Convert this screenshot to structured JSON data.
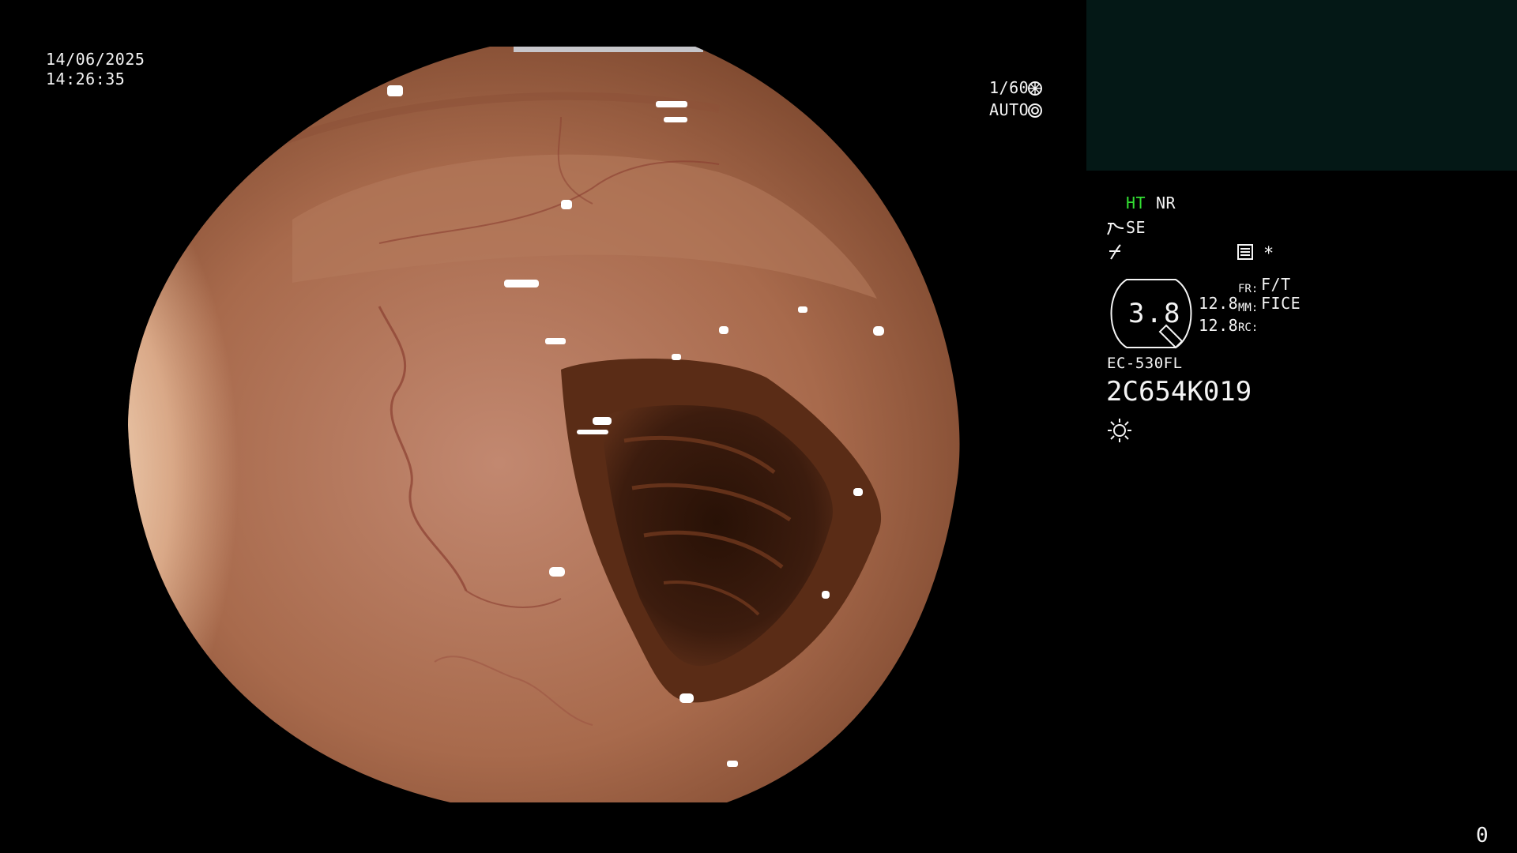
{
  "overlay": {
    "date": "14/06/2025",
    "time": "14:26:35",
    "shutter": "1/60",
    "exposure": "AUTO",
    "counter": "0"
  },
  "processor": {
    "ht_label": "HT",
    "nr_label": "NR",
    "se_label": "SE",
    "asterisk": "*",
    "zoom_value": "3.8",
    "values": [
      "12.8",
      "12.8"
    ],
    "fr_label": "FR:",
    "fr_value": "F/T",
    "mm_label": "MM:",
    "mm_value": "FICE",
    "rc_label": "RC:",
    "scope_model": "EC-530FL",
    "serial": "2C654K019"
  },
  "colors": {
    "ht_green": "#33e033",
    "panel": "#041816",
    "mucosa": "#a86a4c"
  }
}
